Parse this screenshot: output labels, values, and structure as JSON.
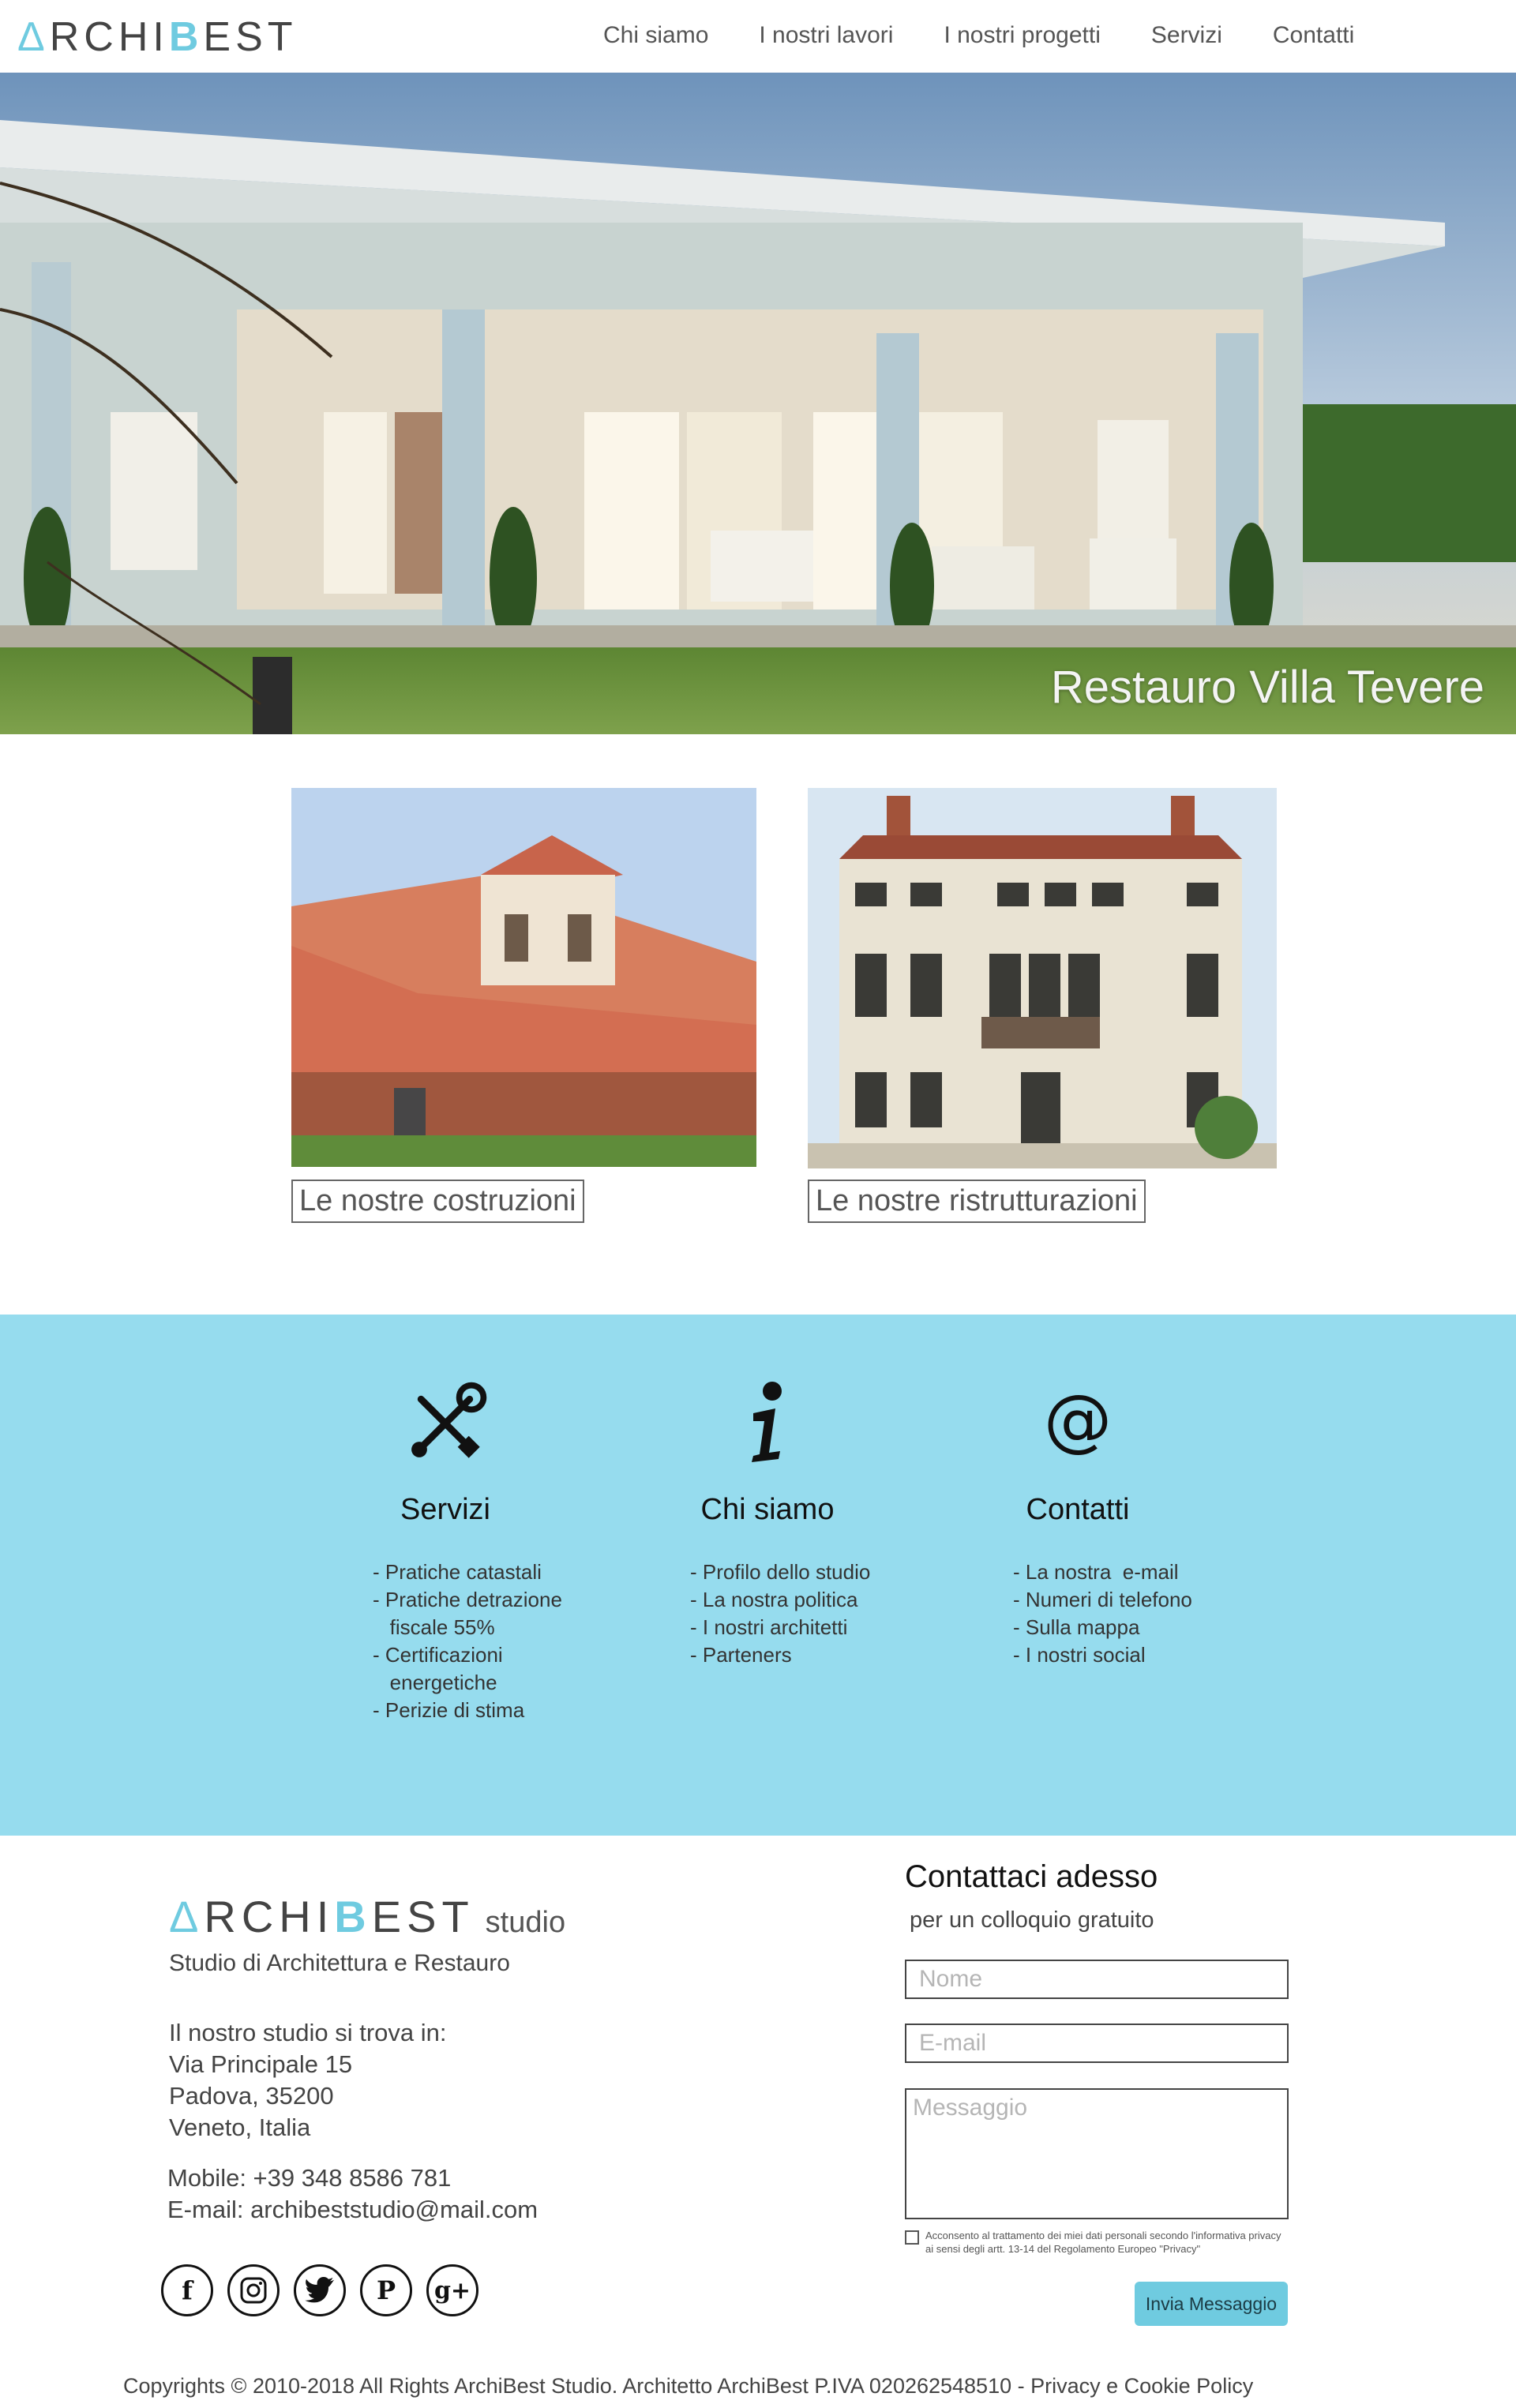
{
  "header": {
    "logo_prefix": "Δ",
    "logo_text1": "RCHI",
    "logo_text2": "B",
    "logo_text3": "EST",
    "nav": [
      "Chi siamo",
      "I nostri lavori",
      "I nostri progetti",
      "Servizi",
      "Contatti"
    ]
  },
  "hero": {
    "caption": "Restauro Villa Tevere"
  },
  "works": [
    {
      "caption": "Le nostre costruzioni"
    },
    {
      "caption": "Le nostre ristrutturazioni"
    }
  ],
  "features": [
    {
      "icon": "tools-icon",
      "title": "Servizi",
      "items": [
        "- Pratiche catastali",
        "- Pratiche detrazione",
        "   fiscale 55%",
        "- Certificazioni",
        "   energetiche",
        "- Perizie di stima"
      ]
    },
    {
      "icon": "info-icon",
      "title": "Chi siamo",
      "items": [
        "- Profilo dello studio",
        "- La nostra politica",
        "- I nostri architetti",
        "- Parteners"
      ]
    },
    {
      "icon": "at-icon",
      "title": "Contatti",
      "items": [
        "- La nostra  e-mail",
        "- Numeri di telefono",
        "- Sulla mappa",
        "- I nostri social"
      ]
    }
  ],
  "footer": {
    "logo_studio": "studio",
    "tagline": "Studio di Architettura e Restauro",
    "address": [
      "Il nostro studio si trova in:",
      "Via Principale 15",
      "Padova, 35200",
      "Veneto, Italia"
    ],
    "mobile": "Mobile: +39 348 8586 781",
    "email": "E-mail: archibeststudio@mail.com",
    "socials": [
      "facebook-icon",
      "instagram-icon",
      "twitter-icon",
      "pinterest-icon",
      "google-plus-icon"
    ],
    "copyright": "Copyrights © 2010-2018 All Rights ArchiBest Studio.  Architetto ArchiBest P.IVA 020262548510 - Privacy e Cookie Policy"
  },
  "form": {
    "title": "Contattaci adesso",
    "subtitle": "per un colloquio gratuito",
    "name_placeholder": "Nome",
    "email_placeholder": "E-mail",
    "message_placeholder": "Messaggio",
    "consent": "Acconsento al trattamento dei miei dati personali secondo l'informativa privacy ai sensi degli artt. 13-14 del Regolamento Europeo \"Privacy\"",
    "submit": "Invia Messaggio"
  },
  "colors": {
    "accent": "#6fcbe0",
    "features_bg": "#96dcee"
  }
}
